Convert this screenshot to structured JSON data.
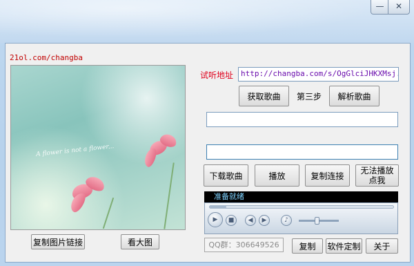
{
  "window": {
    "minimize_glyph": "—",
    "close_glyph": "✕"
  },
  "site_label": "21ol.com/changba",
  "cover": {
    "overlay_text": "A flower is not a flower..."
  },
  "left_buttons": {
    "copy_image_link": "复制图片链接",
    "view_large": "看大图"
  },
  "listen_label": "试听地址",
  "url_value": "http://changba.com/s/OgGlciJHKXMsj.",
  "step": {
    "get_song": "获取歌曲",
    "step_three": "第三步",
    "parse_song": "解析歌曲"
  },
  "field1_value": "",
  "field2_value": "",
  "action_buttons": {
    "download": "下载歌曲",
    "play": "播放",
    "copy_link": "复制连接",
    "cannot_play": "无法播放点我"
  },
  "player": {
    "status": "准备就绪",
    "volume": 0.45,
    "position": 0.0
  },
  "bottom": {
    "qq_group": "QQ群：306649526",
    "copy": "复制",
    "customize": "软件定制",
    "about": "关于"
  },
  "colors": {
    "accent_red": "#e0001b",
    "url_purple": "#6a0dad",
    "player_text": "#7fd2ff"
  }
}
